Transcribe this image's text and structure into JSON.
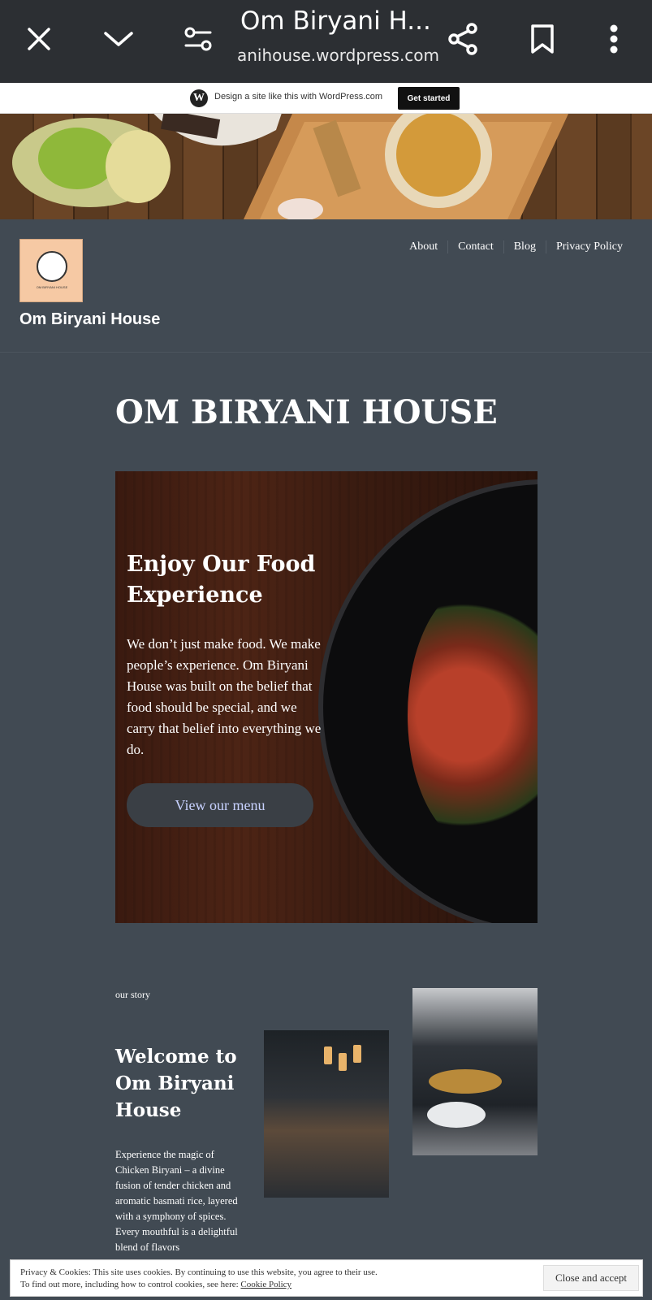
{
  "browser": {
    "title": "Om Biryani H...",
    "url": "anihouse.wordpress.com",
    "icons": [
      "close-icon",
      "chevron-down-icon",
      "tune-icon",
      "share-icon",
      "bookmark-icon",
      "more-vert-icon"
    ]
  },
  "wp_banner": {
    "text": "Design a site like this with WordPress.com",
    "cta": "Get started"
  },
  "site": {
    "logo_text": "OM BIRYANI HOUSE",
    "name": "Om Biryani House",
    "nav": [
      "About",
      "Contact",
      "Blog",
      "Privacy Policy"
    ]
  },
  "main": {
    "page_title": "OM BIRYANI HOUSE",
    "cover": {
      "heading": "Enjoy Our Food Experience",
      "text": "We don’t just make food. We make people’s experience. Om Biryani House was built on the belief that food should be special, and we carry that belief into everything we do.",
      "button": "View our menu"
    },
    "story": {
      "tag": "our story",
      "heading": "Welcome to Om Biryani House",
      "text": "Experience the magic of Chicken Biryani – a divine fusion of tender chicken and aromatic basmati rice, layered with a symphony of spices. Every mouthful is a delightful blend of flavors"
    }
  },
  "cookie": {
    "line1": "Privacy & Cookies: This site uses cookies. By continuing to use this website, you agree to their use.",
    "line2_prefix": "To find out more, including how to control cookies, see here: ",
    "link": "Cookie Policy",
    "button": "Close and accept"
  },
  "colors": {
    "page_bg": "#414a53",
    "toolbar_bg": "#2c2f33",
    "button_text": "#c8d2ff"
  }
}
